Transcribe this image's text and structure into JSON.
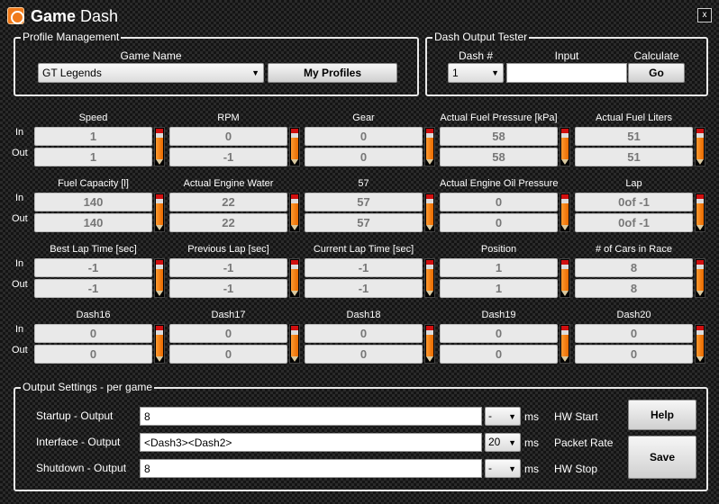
{
  "app": {
    "title_bold": "Game",
    "title_rest": "Dash",
    "close": "x"
  },
  "profile": {
    "group_label": "Profile Management",
    "game_name_label": "Game Name",
    "game_selected": "GT Legends",
    "my_profiles": "My Profiles"
  },
  "tester": {
    "group_label": "Dash Output Tester",
    "dash_label": "Dash #",
    "input_label": "Input",
    "calculate_label": "Calculate",
    "dash_selected": "1",
    "input_value": "",
    "go": "Go"
  },
  "io_labels": {
    "in": "In",
    "out": "Out"
  },
  "dashes": [
    {
      "label": "Speed",
      "in": "1",
      "out": "1"
    },
    {
      "label": "RPM",
      "in": "0",
      "out": "-1"
    },
    {
      "label": "Gear",
      "in": "0",
      "out": "0"
    },
    {
      "label": "Actual Fuel Pressure [kPa]",
      "in": "58",
      "out": "58"
    },
    {
      "label": "Actual Fuel Liters",
      "in": "51",
      "out": "51"
    },
    {
      "label": "Fuel Capacity [l]",
      "in": "140",
      "out": "140"
    },
    {
      "label": "Actual Engine Water",
      "in": "22",
      "out": "22"
    },
    {
      "label": "57",
      "in": "57",
      "out": "57"
    },
    {
      "label": "Actual Engine Oil Pressure",
      "in": "0",
      "out": "0"
    },
    {
      "label": "Lap",
      "in": "0of -1",
      "out": "0of -1"
    },
    {
      "label": "Best Lap Time [sec]",
      "in": "-1",
      "out": "-1"
    },
    {
      "label": "Previous Lap [sec]",
      "in": "-1",
      "out": "-1"
    },
    {
      "label": "Current Lap Time [sec]",
      "in": "-1",
      "out": "-1"
    },
    {
      "label": "Position",
      "in": "1",
      "out": "1"
    },
    {
      "label": "# of Cars in Race",
      "in": "8",
      "out": "8"
    },
    {
      "label": "Dash16",
      "in": "0",
      "out": "0"
    },
    {
      "label": "Dash17",
      "in": "0",
      "out": "0"
    },
    {
      "label": "Dash18",
      "in": "0",
      "out": "0"
    },
    {
      "label": "Dash19",
      "in": "0",
      "out": "0"
    },
    {
      "label": "Dash20",
      "in": "0",
      "out": "0"
    }
  ],
  "output": {
    "group_label": "Output Settings - per game",
    "rows": [
      {
        "label": "Startup - Output",
        "value": "8",
        "ms_value": "-",
        "unit": "ms",
        "right_label": "HW Start"
      },
      {
        "label": "Interface - Output",
        "value": "<Dash3><Dash2>",
        "ms_value": "20",
        "unit": "ms",
        "right_label": "Packet Rate"
      },
      {
        "label": "Shutdown - Output",
        "value": "8",
        "ms_value": "-",
        "unit": "ms",
        "right_label": "HW Stop"
      }
    ],
    "help": "Help",
    "save": "Save"
  },
  "colors": {
    "accent": "#f07a1a",
    "field_bg": "#e9e9e9"
  }
}
